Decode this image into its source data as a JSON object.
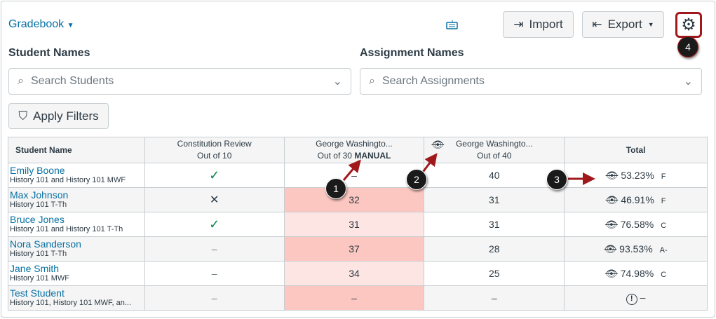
{
  "header": {
    "title": "Gradebook",
    "import_label": "Import",
    "export_label": "Export"
  },
  "filters": {
    "students_label": "Student Names",
    "students_placeholder": "Search Students",
    "assignments_label": "Assignment Names",
    "assignments_placeholder": "Search Assignments",
    "apply_label": "Apply Filters"
  },
  "table": {
    "columns": [
      {
        "title": "Student Name"
      },
      {
        "title": "Constitution Review",
        "sub": "Out of 10"
      },
      {
        "title": "George Washingto...",
        "sub": "Out of 30",
        "tag": "MANUAL"
      },
      {
        "title": "George Washingto...",
        "sub": "Out of 40"
      },
      {
        "title": "Total"
      }
    ],
    "rows": [
      {
        "name": "Emily Boone",
        "section": "History 101 and History 101 MWF",
        "c1": "check",
        "c2": "–",
        "c2bg": "",
        "c3": "40",
        "total": "53.23%",
        "grade": "F"
      },
      {
        "name": "Max Johnson",
        "section": "History 101 T-Th",
        "c1": "x",
        "c2": "32",
        "c2bg": "pk",
        "c3": "31",
        "total": "46.91%",
        "grade": "F"
      },
      {
        "name": "Bruce Jones",
        "section": "History 101 and History 101 T-Th",
        "c1": "check",
        "c2": "31",
        "c2bg": "lp",
        "c3": "31",
        "total": "76.58%",
        "grade": "C"
      },
      {
        "name": "Nora Sanderson",
        "section": "History 101 T-Th",
        "c1": "–",
        "c2": "37",
        "c2bg": "pk",
        "c3": "28",
        "total": "93.53%",
        "grade": "A-"
      },
      {
        "name": "Jane Smith",
        "section": "History 101 MWF",
        "c1": "–",
        "c2": "34",
        "c2bg": "lp",
        "c3": "25",
        "total": "74.98%",
        "grade": "C"
      },
      {
        "name": "Test Student",
        "section": "History 101, History 101 MWF, an...",
        "c1": "–",
        "c2": "–",
        "c2bg": "pk",
        "c3": "–",
        "total": "–",
        "grade": "",
        "warn": true
      }
    ]
  },
  "callouts": [
    "1",
    "2",
    "3",
    "4"
  ],
  "colors": {
    "link": "#0770a3",
    "check": "#0b874b",
    "callout_border": "#a0181c",
    "arrow": "#a0181c"
  }
}
